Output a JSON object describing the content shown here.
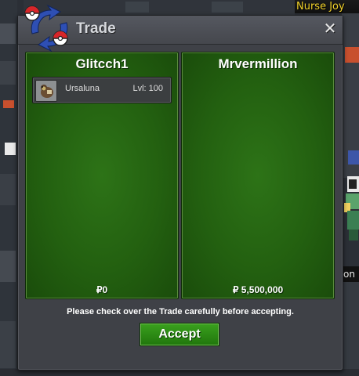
{
  "world": {
    "npc_name": "Nurse Joy",
    "side_text": "on"
  },
  "trade": {
    "title": "Trade",
    "close_glyph": "✕",
    "left": {
      "player": "Glitcch1",
      "money": "₽0",
      "items": [
        {
          "name": "Ursaluna",
          "level": "Lvl: 100"
        }
      ]
    },
    "right": {
      "player": "Mrvermillion",
      "money": "₽ 5,500,000",
      "items": []
    },
    "notice": "Please check over the Trade carefully before accepting.",
    "accept_label": "Accept"
  },
  "colors": {
    "panel_green": "#236010",
    "accept_green": "#2d8a15",
    "window_gray": "#3f4147",
    "npc_label": "#f2d22a"
  },
  "icons": [
    "pokeball-logo-icon",
    "close-icon",
    "pokemon-icon"
  ]
}
